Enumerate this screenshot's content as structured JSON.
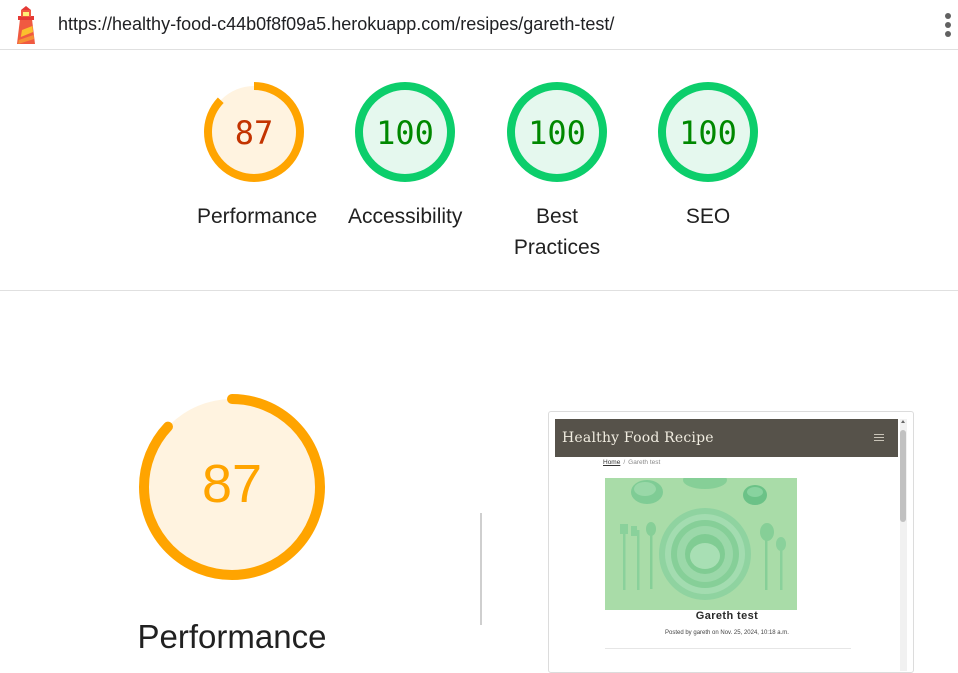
{
  "topbar": {
    "url": "https://healthy-food-c44b0f8f09a5.herokuapp.com/resipes/gareth-test/"
  },
  "gauges": [
    {
      "label": "Performance",
      "score": "87",
      "fraction": 0.87,
      "color": "#ffa400",
      "fill": "#fff3e0",
      "text_color": "#c33300"
    },
    {
      "label": "Accessibility",
      "score": "100",
      "fraction": 1.0,
      "color": "#0cce6b",
      "fill": "#e5f8ee",
      "text_color": "#008800"
    },
    {
      "label": "Best Practices",
      "score": "100",
      "fraction": 1.0,
      "color": "#0cce6b",
      "fill": "#e5f8ee",
      "text_color": "#008800"
    },
    {
      "label": "SEO",
      "score": "100",
      "fraction": 1.0,
      "color": "#0cce6b",
      "fill": "#e5f8ee",
      "text_color": "#008800"
    }
  ],
  "performance_section": {
    "title": "Performance",
    "score": "87",
    "fraction": 0.87,
    "color": "#ffa400",
    "fill": "#fff3e0",
    "text_color": "#ffa400"
  },
  "screenshot": {
    "brand": "Healthy Food Recipe",
    "breadcrumb_home": "Home",
    "breadcrumb_separator": "/",
    "breadcrumb_current": "Gareth test",
    "recipe_title": "Gareth test",
    "recipe_meta": "Posted by gareth on Nov. 25, 2024, 10:18 a.m.",
    "nav_color": "#56524a",
    "image_bg": "#a9dca8"
  },
  "icons": {
    "logo": "lighthouse-logo-icon",
    "menu": "more-vert-icon",
    "hamburger": "hamburger-menu-icon"
  }
}
